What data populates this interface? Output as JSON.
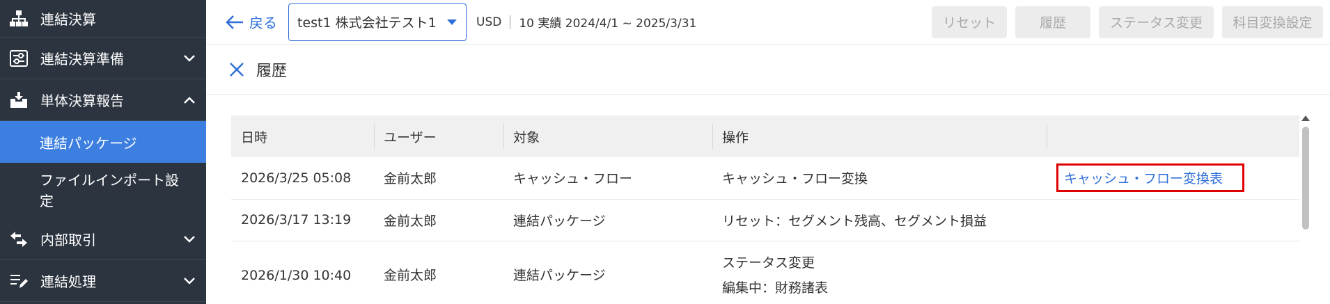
{
  "sidebar": {
    "items": [
      {
        "label": "連結決算",
        "icon": "org-chart-icon"
      },
      {
        "label": "連結決算準備",
        "icon": "sliders-icon"
      },
      {
        "label": "単体決算報告",
        "icon": "inbox-icon"
      },
      {
        "label": "連結パッケージ"
      },
      {
        "label": "ファイルインポート設定"
      },
      {
        "label": "内部取引",
        "icon": "transfer-icon"
      },
      {
        "label": "連結処理",
        "icon": "list-edit-icon"
      }
    ]
  },
  "header": {
    "back_label": "戻る",
    "company": "test1 株式会社テスト1",
    "currency": "USD",
    "period": "10 実績 2024/4/1 ~ 2025/3/31",
    "buttons": [
      "リセット",
      "履歴",
      "ステータス変更",
      "科目変換設定"
    ]
  },
  "panel": {
    "title": "履歴"
  },
  "table": {
    "columns": [
      "日時",
      "ユーザー",
      "対象",
      "操作",
      ""
    ],
    "rows": [
      {
        "datetime": "2026/3/25 05:08",
        "user": "金前太郎",
        "target": "キャッシュ・フロー",
        "operation": "キャッシュ・フロー変換",
        "operation2": "",
        "link": "キャッシュ・フロー変換表"
      },
      {
        "datetime": "2026/3/17 13:19",
        "user": "金前太郎",
        "target": "連結パッケージ",
        "operation": "リセット：セグメント残高、セグメント損益",
        "operation2": "",
        "link": ""
      },
      {
        "datetime": "2026/1/30 10:40",
        "user": "金前太郎",
        "target": "連結パッケージ",
        "operation": "ステータス変更",
        "operation2": "編集中：財務諸表",
        "link": ""
      }
    ]
  },
  "colors": {
    "sidebar_bg": "#2c3440",
    "active_item": "#3d7fe0",
    "link": "#2f6fd8",
    "highlight_box": "#e00000"
  }
}
